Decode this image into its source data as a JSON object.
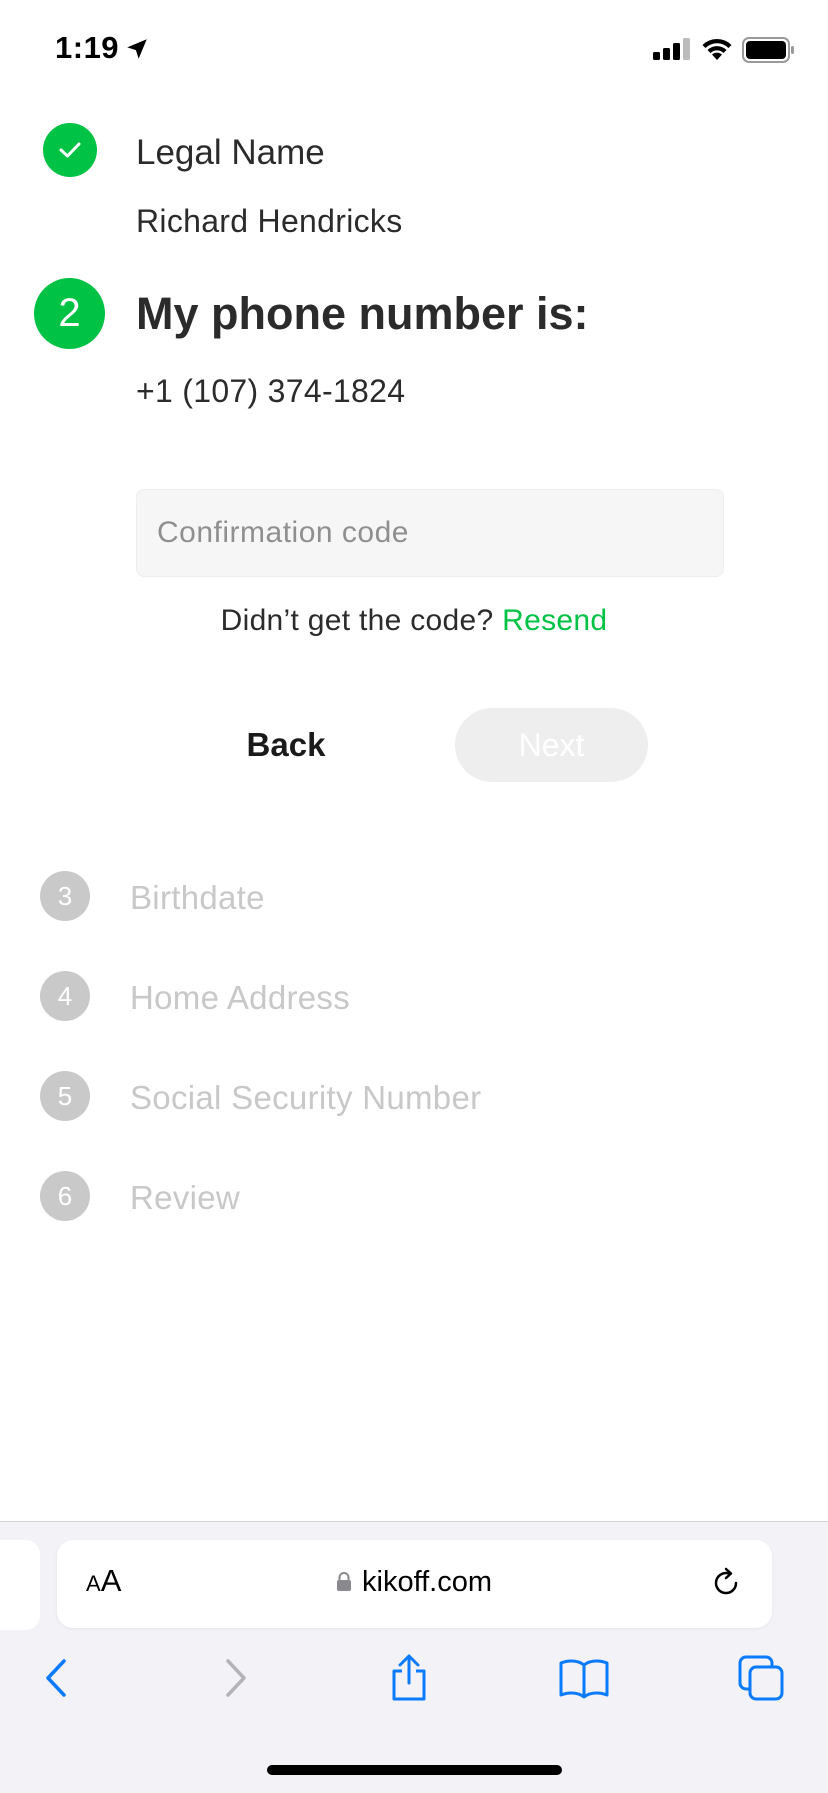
{
  "status_bar": {
    "time": "1:19"
  },
  "steps": {
    "step1": {
      "title": "Legal Name",
      "value": "Richard Hendricks",
      "icon": "checkmark-icon"
    },
    "step2": {
      "number": "2",
      "title": "My phone number is:",
      "phone": "+1 (107) 374-1824",
      "code_placeholder": "Confirmation code",
      "resend_prompt": "Didn’t get the code?",
      "resend_link": "Resend"
    },
    "pending": [
      {
        "number": "3",
        "label": "Birthdate"
      },
      {
        "number": "4",
        "label": "Home Address"
      },
      {
        "number": "5",
        "label": "Social Security Number"
      },
      {
        "number": "6",
        "label": "Review"
      }
    ]
  },
  "buttons": {
    "back": "Back",
    "next": "Next"
  },
  "browser": {
    "aa_small": "A",
    "aa_large": "A",
    "url": "kikoff.com"
  },
  "colors": {
    "accent": "#00c244",
    "pending": "#c8c8c8"
  }
}
